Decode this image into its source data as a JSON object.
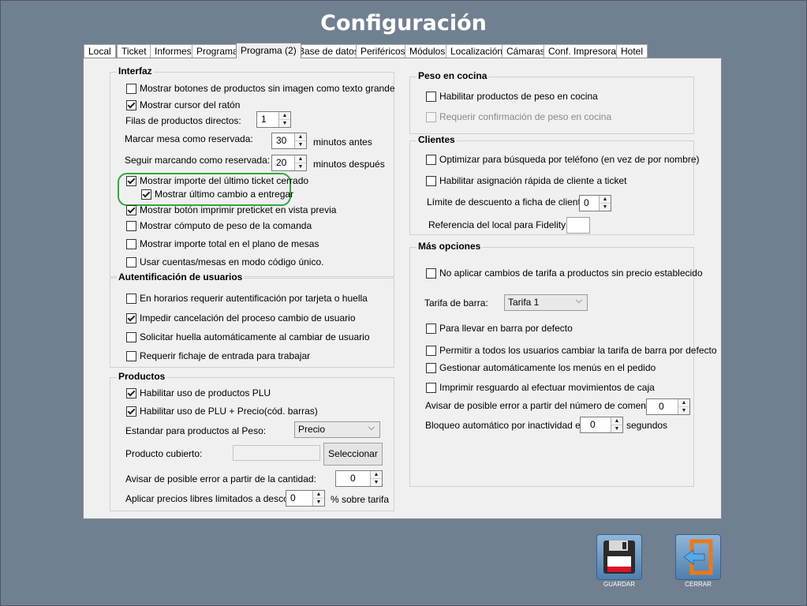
{
  "window": {
    "title": "Configuración"
  },
  "tabs": [
    "Local",
    "Ticket",
    "Informes",
    "Programa",
    "Programa (2)",
    "Base de datos",
    "Periféricos",
    "Módulos",
    "Localización",
    "Cámaras",
    "Conf. Impresoras",
    "Hotel"
  ],
  "active_tab": "Programa (2)",
  "interfaz": {
    "title": "Interfaz",
    "show_text_buttons": "Mostrar botones de productos sin imagen como texto grande",
    "show_cursor": "Mostrar cursor del ratón",
    "direct_rows_label": "Filas de productos directos:",
    "direct_rows_value": "1",
    "reserved_label": "Marcar mesa como reservada:",
    "reserved_value": "30",
    "reserved_unit": "minutos antes",
    "keep_reserved_label": "Seguir marcando como reservada:",
    "keep_reserved_value": "20",
    "keep_reserved_unit": "minutos después",
    "show_last_ticket": "Mostrar importe del último ticket cerrado",
    "show_last_change": "Mostrar último cambio a entregar",
    "show_preticket_button": "Mostrar botón imprimir preticket en vista previa",
    "show_weight_calc": "Mostrar cómputo de peso de la comanda",
    "show_total_plan": "Mostrar importe total en el plano de mesas",
    "unique_code": "Usar cuentas/mesas en modo código único."
  },
  "auth": {
    "title": "Autentificación de usuarios",
    "schedule_auth": "En horarios requerir autentificación por tarjeta o huella",
    "prevent_cancel": "Impedir cancelación del proceso cambio de usuario",
    "request_fingerprint": "Solicitar huella automáticamente al cambiar de usuario",
    "require_checkin": "Requerir fichaje de entrada para trabajar"
  },
  "products": {
    "title": "Productos",
    "enable_plu": "Habilitar uso de productos PLU",
    "enable_plu_price": "Habilitar uso de PLU + Precio(cód. barras)",
    "weight_standard_label": "Estandar para productos al Peso:",
    "weight_standard_value": "Precio",
    "covered_product_label": "Producto cubierto:",
    "select_button": "Seleccionar",
    "qty_warning_label": "Avisar de posible error a partir de la cantidad:",
    "qty_warning_value": "0",
    "free_price_label": "Aplicar precios libres limitados a descontar",
    "free_price_value": "0",
    "free_price_unit": "%  sobre tarifa"
  },
  "kitchen_weight": {
    "title": "Peso en cocina",
    "enable": "Habilitar productos de peso en cocina",
    "require_confirm": "Requerir confirmación de peso en cocina"
  },
  "clients": {
    "title": "Clientes",
    "phone_search": "Optimizar para búsqueda por teléfono (en vez de por nombre)",
    "quick_assign": "Habilitar asignación rápida de cliente a ticket",
    "discount_limit_label": "Límite de descuento a ficha de clientes",
    "discount_limit_value": "0",
    "fidelity_label": "Referencia del local para Fidelity:"
  },
  "more": {
    "title": "Más opciones",
    "no_rate_change": "No aplicar cambios de tarifa a productos sin precio establecido",
    "bar_rate_label": "Tarifa de barra:",
    "bar_rate_value": "Tarifa 1",
    "takeaway_default": "Para llevar en barra por defecto",
    "allow_rate_change": "Permitir a todos los usuarios cambiar la tarifa de barra por defecto",
    "auto_menus": "Gestionar automáticamente los menús en el pedido",
    "print_receipt": "Imprimir resguardo al efectuar movimientos de caja",
    "guests_warning_label": "Avisar de posible error a partir del número de comensales:",
    "guests_warning_value": "0",
    "auto_lock_label": "Bloqueo automático por inactividad en:",
    "auto_lock_value": "0",
    "auto_lock_unit": "segundos"
  },
  "actions": {
    "save": "GUARDAR",
    "close": "CERRAR"
  },
  "colors": {
    "background": "#708090",
    "highlight": "#2eaa3c",
    "save_red": "#d9142a",
    "close_orange": "#e87a1c"
  }
}
